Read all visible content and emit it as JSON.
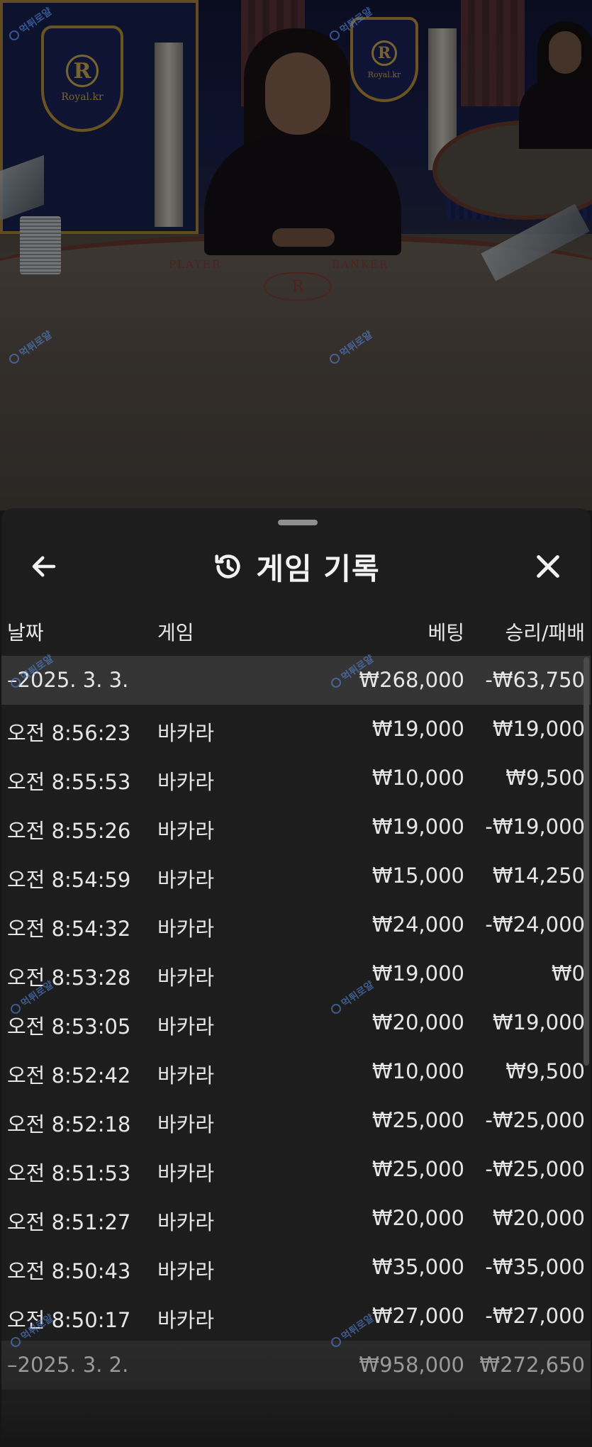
{
  "video": {
    "brand_text": "Royal.kr",
    "brand_letter": "R",
    "table_player_label": "PLAYER",
    "table_banker_label": "BANKER",
    "watermark_text": "먹튀로얄"
  },
  "sheet": {
    "title": "게임 기록",
    "back_icon": "arrow-left-icon",
    "history_icon": "history-icon",
    "close_icon": "close-icon"
  },
  "columns": {
    "date": "날짜",
    "game": "게임",
    "bet": "베팅",
    "result": "승리/패배"
  },
  "days": [
    {
      "date": "–2025. 3. 3.",
      "bet_total": "₩268,000",
      "result_total": "-₩63,750",
      "rows": [
        {
          "time": "오전 8:56:23",
          "game": "바카라",
          "bet": "₩19,000",
          "result": "₩19,000"
        },
        {
          "time": "오전 8:55:53",
          "game": "바카라",
          "bet": "₩10,000",
          "result": "₩9,500"
        },
        {
          "time": "오전 8:55:26",
          "game": "바카라",
          "bet": "₩19,000",
          "result": "-₩19,000"
        },
        {
          "time": "오전 8:54:59",
          "game": "바카라",
          "bet": "₩15,000",
          "result": "₩14,250"
        },
        {
          "time": "오전 8:54:32",
          "game": "바카라",
          "bet": "₩24,000",
          "result": "-₩24,000"
        },
        {
          "time": "오전 8:53:28",
          "game": "바카라",
          "bet": "₩19,000",
          "result": "₩0"
        },
        {
          "time": "오전 8:53:05",
          "game": "바카라",
          "bet": "₩20,000",
          "result": "₩19,000"
        },
        {
          "time": "오전 8:52:42",
          "game": "바카라",
          "bet": "₩10,000",
          "result": "₩9,500"
        },
        {
          "time": "오전 8:52:18",
          "game": "바카라",
          "bet": "₩25,000",
          "result": "-₩25,000"
        },
        {
          "time": "오전 8:51:53",
          "game": "바카라",
          "bet": "₩25,000",
          "result": "-₩25,000"
        },
        {
          "time": "오전 8:51:27",
          "game": "바카라",
          "bet": "₩20,000",
          "result": "₩20,000"
        },
        {
          "time": "오전 8:50:43",
          "game": "바카라",
          "bet": "₩35,000",
          "result": "-₩35,000"
        },
        {
          "time": "오전 8:50:17",
          "game": "바카라",
          "bet": "₩27,000",
          "result": "-₩27,000"
        }
      ]
    },
    {
      "date": "–2025. 3. 2.",
      "bet_total": "₩958,000",
      "result_total": "₩272,650"
    }
  ],
  "colors": {
    "panel_bg": "#1d1d1d",
    "day_row_bg": "#343434",
    "text": "#e6e6e6",
    "plaque_gold": "#c49a3c",
    "plaque_blue": "#1d2660"
  }
}
